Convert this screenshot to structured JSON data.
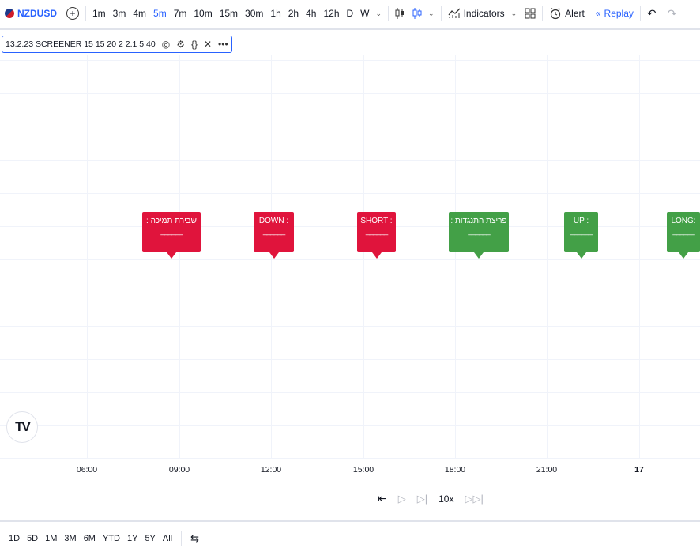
{
  "toolbar": {
    "symbol": "NZDUSD",
    "intervals": [
      "1m",
      "3m",
      "4m",
      "5m",
      "7m",
      "10m",
      "15m",
      "30m",
      "1h",
      "2h",
      "4h",
      "12h",
      "D",
      "W"
    ],
    "active_interval": "5m",
    "indicators_label": "Indicators",
    "alert_label": "Alert",
    "replay_label": "Replay"
  },
  "indicator": {
    "name": "13.2.23 SCREENER",
    "params": "15 15 20 2 2.1 5 40"
  },
  "labels": [
    {
      "text": "שבירת תמיכה :",
      "color": "red"
    },
    {
      "text": "DOWN :",
      "color": "red"
    },
    {
      "text": "SHORT :",
      "color": "red"
    },
    {
      "text": "פריצת התנגדות :",
      "color": "green"
    },
    {
      "text": "UP :",
      "color": "green"
    },
    {
      "text": "LONG:",
      "color": "green"
    }
  ],
  "label_dash": "______",
  "time_axis": [
    "06:00",
    "09:00",
    "12:00",
    "15:00",
    "18:00",
    "21:00",
    "17"
  ],
  "playback": {
    "speed": "10x"
  },
  "ranges": [
    "1D",
    "5D",
    "1M",
    "3M",
    "6M",
    "YTD",
    "1Y",
    "5Y",
    "All"
  ],
  "logo_text": "TV"
}
